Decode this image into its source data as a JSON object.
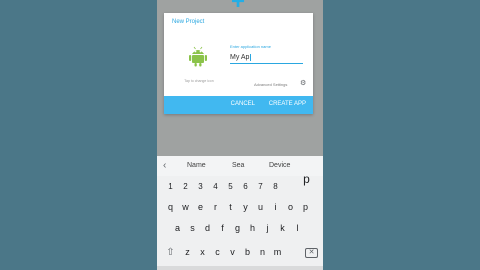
{
  "dialog": {
    "title": "New Project",
    "tap_label": "Tap to change icon",
    "field_placeholder": "Enter application name",
    "app_name_value": "My Ap",
    "advanced_settings": "Advanced Settings",
    "cancel_label": "CANCEL",
    "create_label": "CREATE APP"
  },
  "keyboard": {
    "suggestions": [
      "Name",
      "Sea",
      "Device"
    ],
    "number_row": [
      "1",
      "2",
      "3",
      "4",
      "5",
      "6",
      "7",
      "8"
    ],
    "number_extra": "p",
    "row1": [
      "q",
      "w",
      "e",
      "r",
      "t",
      "y",
      "u",
      "i",
      "o",
      "p"
    ],
    "row2": [
      "a",
      "s",
      "d",
      "f",
      "g",
      "h",
      "j",
      "k",
      "l"
    ],
    "row3": [
      "z",
      "x",
      "c",
      "v",
      "b",
      "n",
      "m"
    ]
  },
  "icons": {
    "plus": "plus-icon",
    "android": "android-icon",
    "gear": "gear-icon",
    "back": "chevron-left-icon",
    "shift": "shift-icon",
    "backspace": "backspace-icon"
  },
  "colors": {
    "background": "#4b7788",
    "accent": "#2aa7e0",
    "action_bar": "#41b8f0",
    "android_green": "#8bc34a"
  }
}
